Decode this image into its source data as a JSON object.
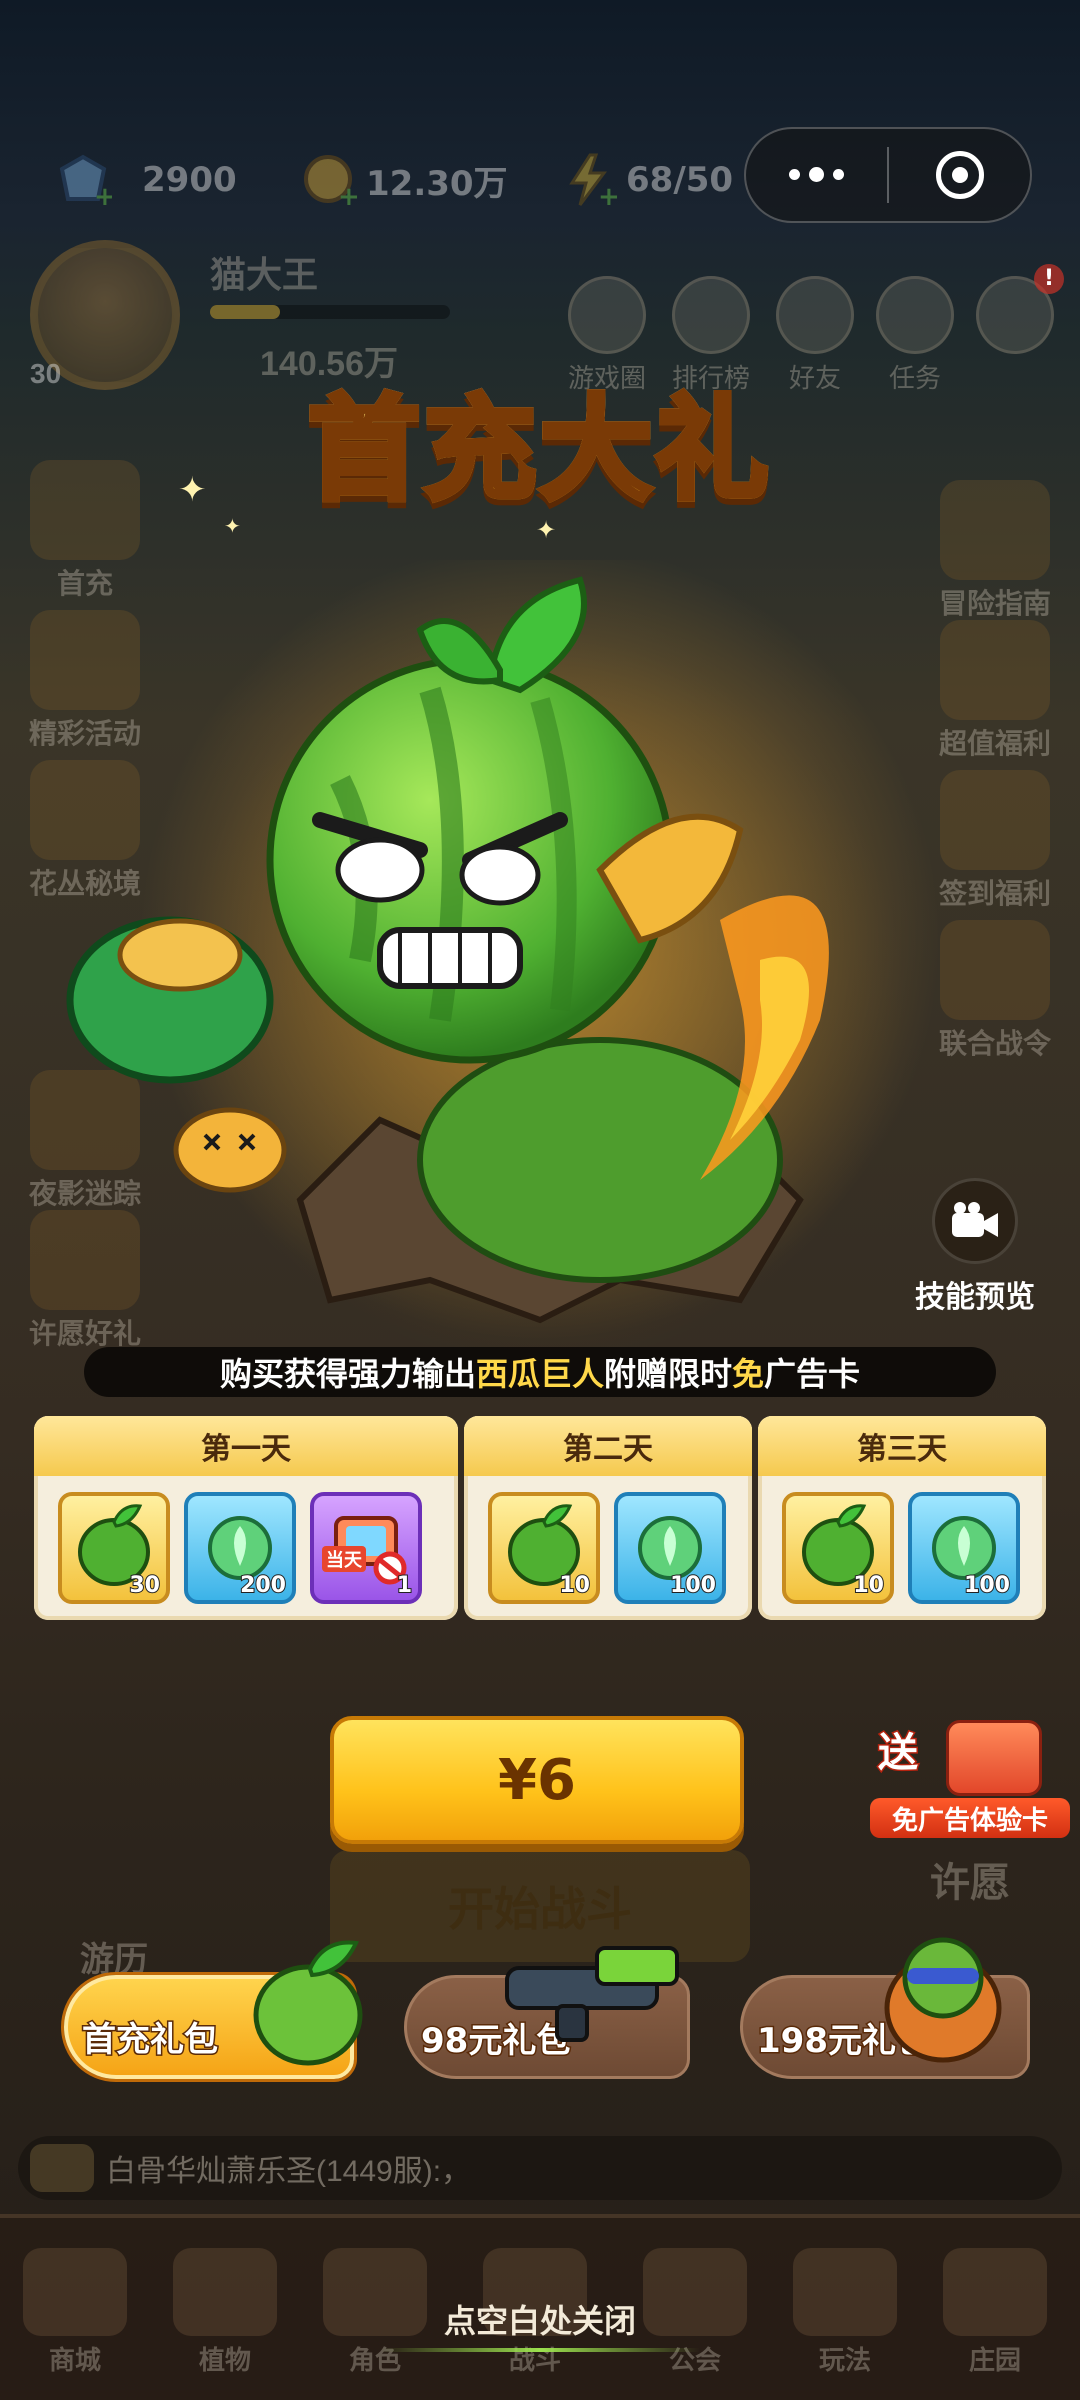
{
  "resources": [
    {
      "name": "diamond",
      "value": "2900"
    },
    {
      "name": "coin",
      "value": "12.30万"
    },
    {
      "name": "energy",
      "value": "68/50"
    }
  ],
  "player": {
    "name": "猫大王",
    "level": "30",
    "power": "140.56万"
  },
  "top_menu": [
    "游戏圈",
    "排行榜",
    "好友",
    "任务"
  ],
  "left_menu": [
    "首充",
    "精彩活动",
    "花丛秘境",
    "夜影迷踪",
    "许愿好礼"
  ],
  "right_menu": [
    "冒险指南",
    "超值福利",
    "签到福利",
    "联合战令"
  ],
  "popup": {
    "title": "首充大礼",
    "skill_preview_label": "技能预览",
    "banner": {
      "prefix": "购买获得强力输出",
      "highlight1": "西瓜巨人",
      "middle": "附赠限时",
      "highlight2": "免",
      "suffix": "广告卡"
    },
    "days": [
      {
        "title": "第一天",
        "items": [
          {
            "icon": "watermelon-giant-card-icon",
            "qty": "30",
            "style": "gold"
          },
          {
            "icon": "seed-crystal-icon",
            "qty": "200",
            "style": "blue"
          },
          {
            "icon": "ad-free-tv-icon",
            "qty": "1",
            "style": "purple",
            "tag": "当天"
          }
        ]
      },
      {
        "title": "第二天",
        "items": [
          {
            "icon": "watermelon-giant-card-icon",
            "qty": "10",
            "style": "gold"
          },
          {
            "icon": "seed-crystal-icon",
            "qty": "100",
            "style": "blue"
          }
        ]
      },
      {
        "title": "第三天",
        "items": [
          {
            "icon": "watermelon-giant-card-icon",
            "qty": "10",
            "style": "gold"
          },
          {
            "icon": "seed-crystal-icon",
            "qty": "100",
            "style": "blue"
          }
        ]
      }
    ],
    "price_label": "¥6",
    "gift_badge": {
      "send": "送",
      "label": "免广告体验卡"
    },
    "packs": [
      {
        "label": "首充礼包",
        "active": true
      },
      {
        "label": "98元礼包",
        "active": false
      },
      {
        "label": "198元礼包",
        "active": false
      }
    ],
    "close_hint": "点空白处关闭"
  },
  "behind": {
    "start_button": "开始战斗",
    "left_bottom": "游历",
    "right_bottom": "许愿"
  },
  "chat": "白骨华灿萧乐圣(1449服):，",
  "tabs": [
    "商城",
    "植物",
    "角色",
    "战斗",
    "公会",
    "玩法",
    "庄园"
  ],
  "colors": {
    "accent_gold": "#ffc21a",
    "highlight_yellow": "#ffd84a",
    "leaf_green": "#3fbf3a"
  }
}
